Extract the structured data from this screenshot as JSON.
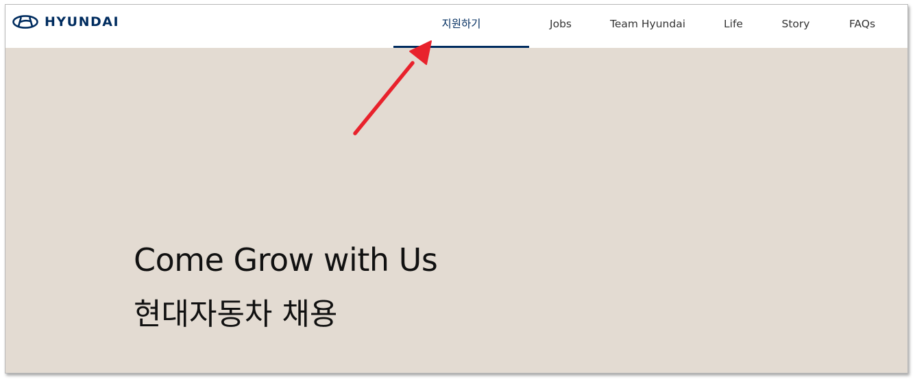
{
  "brand": {
    "name": "HYUNDAI",
    "color": "#002c5f"
  },
  "nav": {
    "items": [
      {
        "label": "지원하기",
        "active": true
      },
      {
        "label": "Jobs",
        "active": false
      },
      {
        "label": "Team Hyundai",
        "active": false
      },
      {
        "label": "Life",
        "active": false
      },
      {
        "label": "Story",
        "active": false
      },
      {
        "label": "FAQs",
        "active": false
      }
    ]
  },
  "hero": {
    "title": "Come Grow with Us",
    "subtitle": "현대자동차 채용",
    "background_color": "#e3dbd2"
  },
  "annotation": {
    "arrow_color": "#e8222c",
    "icon": "red-arrow-icon"
  }
}
